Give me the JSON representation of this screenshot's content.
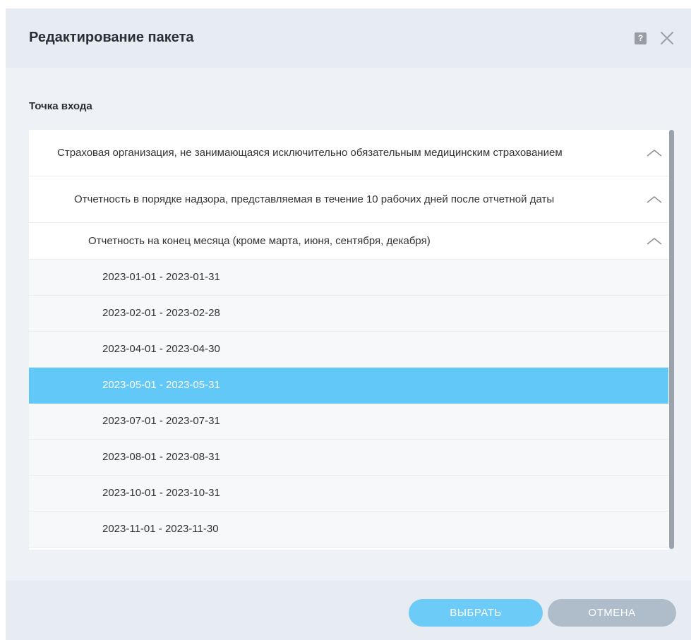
{
  "dialog": {
    "title": "Редактирование пакета",
    "help_label": "?"
  },
  "entry_point": {
    "label": "Точка входа"
  },
  "tree": {
    "items": [
      {
        "label": "Страховая организация, не занимающаяся исключительно обязательным медицинским страхованием",
        "level": 0,
        "expanded": true,
        "selected": false
      },
      {
        "label": "Отчетность в порядке надзора, представляемая в течение 10 рабочих дней после отчетной даты",
        "level": 1,
        "expanded": true,
        "selected": false
      },
      {
        "label": "Отчетность на конец месяца (кроме марта, июня, сентября, декабря)",
        "level": 2,
        "expanded": true,
        "selected": false
      },
      {
        "label": "2023-01-01 - 2023-01-31",
        "level": 3,
        "selected": false
      },
      {
        "label": "2023-02-01 - 2023-02-28",
        "level": 3,
        "selected": false
      },
      {
        "label": "2023-04-01 - 2023-04-30",
        "level": 3,
        "selected": false
      },
      {
        "label": "2023-05-01 - 2023-05-31",
        "level": 3,
        "selected": true
      },
      {
        "label": "2023-07-01 - 2023-07-31",
        "level": 3,
        "selected": false
      },
      {
        "label": "2023-08-01 - 2023-08-31",
        "level": 3,
        "selected": false
      },
      {
        "label": "2023-10-01 - 2023-10-31",
        "level": 3,
        "selected": false
      },
      {
        "label": "2023-11-01 - 2023-11-30",
        "level": 3,
        "selected": false
      }
    ]
  },
  "buttons": {
    "select_label": "ВЫБРАТЬ",
    "cancel_label": "ОТМЕНА"
  },
  "colors": {
    "selected_row": "#62c8f7",
    "primary_button": "#6cccf7",
    "secondary_button": "#afbdca"
  },
  "icons": {
    "help": "help-icon",
    "close": "close-icon",
    "collapse": "chevron-up-icon"
  }
}
